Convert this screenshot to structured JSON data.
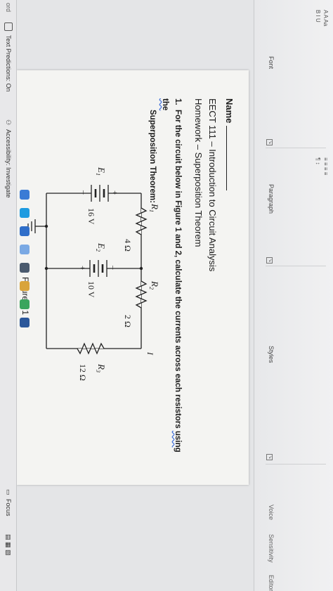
{
  "ribbon": {
    "groups": [
      {
        "label": "Font"
      },
      {
        "label": "Paragraph"
      },
      {
        "label": "Styles"
      }
    ],
    "right_tools": [
      "Voice",
      "Sensitivity",
      "Editor"
    ]
  },
  "document": {
    "name_label": "Name",
    "title": "EECT 111 – Introduction to Circuit Analysis",
    "subtitle": "Homework – Superposition Theorem",
    "question": {
      "number": "1.",
      "line1_pre": "For the circuit below in Figure 1 and 2, calculate the currents across each resistors ",
      "line1_underlined": "using the",
      "line2": "Superposition Theorem:"
    },
    "figure": {
      "caption": "Figure # 1",
      "current_label": "I",
      "R1": "R",
      "R1_sub": "1",
      "R1_value": "4 Ω",
      "R2": "R",
      "R2_sub": "2",
      "R2_value": "2 Ω",
      "R3": "R",
      "R3_sub": "3",
      "R3_value": "12 Ω",
      "E1": "E",
      "E1_sub": "1",
      "E1_value": "16 V",
      "E2": "E",
      "E2_sub": "2",
      "E2_value": "10 V",
      "plus": "+",
      "minus": "–"
    }
  },
  "statusbar": {
    "left_fragment": "ord",
    "text_predictions": "Text Predictions: On",
    "accessibility": "Accessibility: Investigate",
    "focus": "Focus"
  },
  "colors": {
    "accent": "#2b579a",
    "spellcheck": "#3a6bd8"
  }
}
